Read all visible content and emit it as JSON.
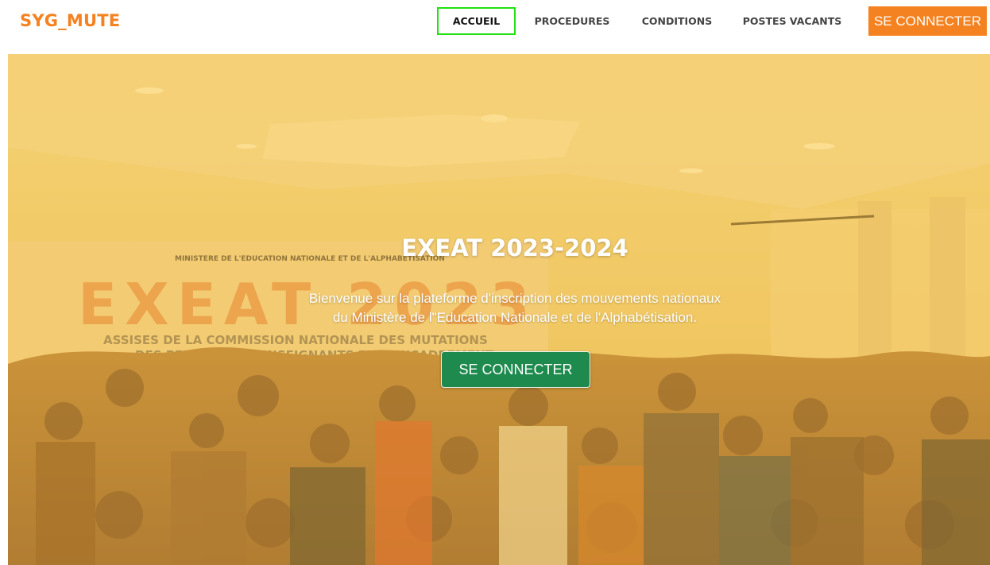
{
  "brand": {
    "name": "SYG_MUTE",
    "color": "#f58220"
  },
  "nav": {
    "items": [
      {
        "label": "ACCUEIL",
        "active": true
      },
      {
        "label": "PROCEDURES",
        "active": false
      },
      {
        "label": "CONDITIONS",
        "active": false
      },
      {
        "label": "POSTES VACANTS",
        "active": false
      }
    ],
    "login_button": "SE CONNECTER"
  },
  "hero": {
    "title": "EXEAT 2023-2024",
    "description_line1": "Bienvenue sur la plateforme d'inscription des mouvements nationaux",
    "description_line2": "du Ministère de l\"Education Nationale et de l'Alphabétisation.",
    "button": "SE CONNECTER",
    "banner_heading": "MINISTERE DE L'EDUCATION NATIONALE ET DE L'ALPHABETISATION",
    "banner_event": "EXEAT 2023",
    "banner_line1": "ASSISES DE LA COMMISSION NATIONALE DES MUTATIONS",
    "banner_line2": "DES PERSONNELS ENSEIGNANTS ET D'ENCADREMENT"
  },
  "colors": {
    "accent": "#f58220",
    "primary_button": "#1f8a4d",
    "active_outline": "#22e010",
    "hero_overlay": "#f7b928"
  }
}
